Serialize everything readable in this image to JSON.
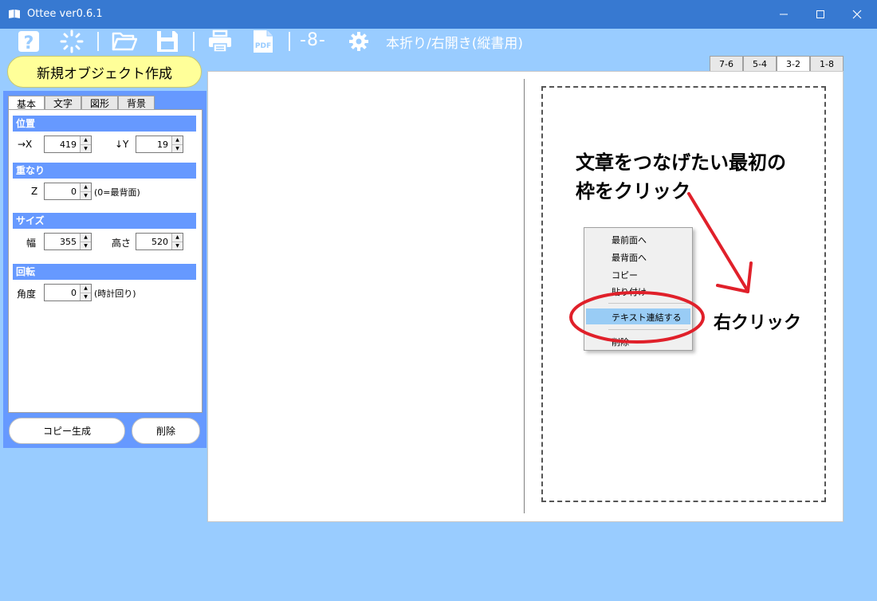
{
  "window": {
    "title": "Ottee ver0.6.1"
  },
  "toolbar": {
    "page_counter": "-8-",
    "mode_label": "本折り/右開き(縦書用)"
  },
  "left_panel": {
    "new_object_label": "新規オブジェクト作成",
    "tabs": [
      {
        "label": "基本",
        "active": true
      },
      {
        "label": "文字",
        "active": false
      },
      {
        "label": "図形",
        "active": false
      },
      {
        "label": "背景",
        "active": false
      }
    ],
    "sections": {
      "position": {
        "title": "位置",
        "x_label": "→X",
        "x_value": "419",
        "y_label": "↓Y",
        "y_value": "19"
      },
      "overlap": {
        "title": "重なり",
        "z_label": "Z",
        "z_value": "0",
        "z_note": "(0=最背面)"
      },
      "size": {
        "title": "サイズ",
        "width_label": "幅",
        "width_value": "355",
        "height_label": "高さ",
        "height_value": "520"
      },
      "rotation": {
        "title": "回転",
        "angle_label": "角度",
        "angle_value": "0",
        "angle_note": "(時計回り)"
      }
    },
    "copy_button": "コピー生成",
    "delete_button": "削除"
  },
  "page_tabs": [
    {
      "label": "7-6",
      "active": false
    },
    {
      "label": "5-4",
      "active": false
    },
    {
      "label": "3-2",
      "active": true
    },
    {
      "label": "1-8",
      "active": false
    }
  ],
  "context_menu": {
    "items": [
      "最前面へ",
      "最背面へ",
      "コピー",
      "貼り付け",
      "テキスト連結する",
      "削除"
    ],
    "highlighted": "テキスト連結する"
  },
  "annotations": {
    "instruction_line1": "文章をつなげたい最初の",
    "instruction_line2": "枠をクリック",
    "right_click": "右クリック"
  },
  "colors": {
    "title_bar": "#3779d1",
    "background": "#99ccff",
    "panel": "#6699ff",
    "new_object_button": "#ffff99",
    "annotation_red": "#e0202a",
    "menu_highlight": "#99ccf5"
  }
}
